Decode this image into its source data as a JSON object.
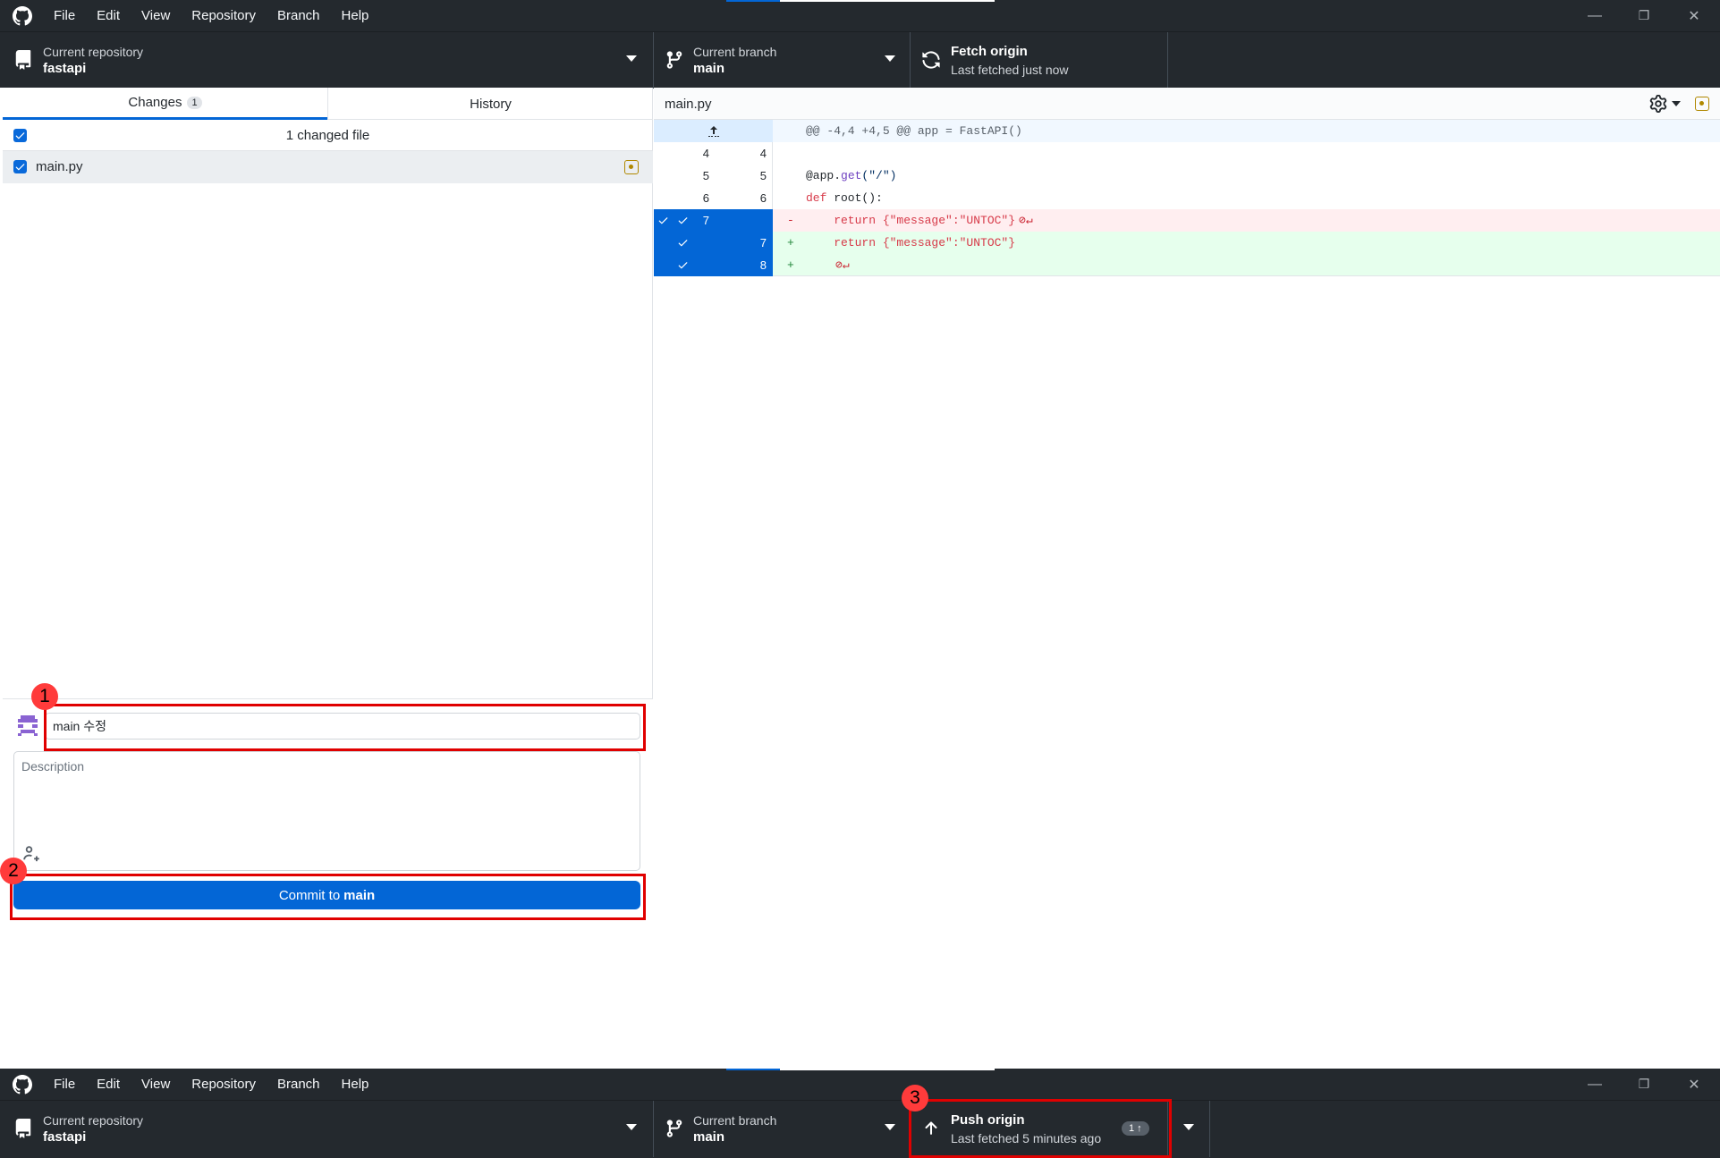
{
  "app": {
    "menu": [
      "File",
      "Edit",
      "View",
      "Repository",
      "Branch",
      "Help"
    ],
    "window_controls": {
      "minimize": "—",
      "restore": "❐",
      "close": "✕"
    }
  },
  "toolbar_top": {
    "repo_label": "Current repository",
    "repo_name": "fastapi",
    "branch_label": "Current branch",
    "branch_name": "main",
    "fetch_title": "Fetch origin",
    "fetch_sub": "Last fetched just now"
  },
  "tabs": {
    "changes_label": "Changes",
    "changes_count": "1",
    "history_label": "History"
  },
  "changes": {
    "header": "1 changed file",
    "files": [
      {
        "name": "main.py"
      }
    ]
  },
  "commit": {
    "summary_value": "main 수정",
    "description_placeholder": "Description",
    "button_prefix": "Commit to",
    "button_branch": "main"
  },
  "diff": {
    "file_name": "main.py",
    "hunk_header": "@@ -4,4 +4,5 @@ app = FastAPI()",
    "lines": [
      {
        "old": "4",
        "new": "4",
        "sign": "",
        "code": ""
      },
      {
        "old": "5",
        "new": "5",
        "sign": "",
        "code_pre": "@app.",
        "code_fn": "get",
        "code_post": "(\"/\")"
      },
      {
        "old": "6",
        "new": "6",
        "sign": "",
        "code_kw": "def",
        "code_rest": " root():"
      },
      {
        "old": "7",
        "new": "",
        "sign": "-",
        "code": "    return {\"message\":\"UNTOC\"}",
        "trail": "⊘↵"
      },
      {
        "old": "",
        "new": "7",
        "sign": "+",
        "code": "    return {\"message\":\"UNTOC\"}"
      },
      {
        "old": "",
        "new": "8",
        "sign": "+",
        "code": "",
        "trail": "⊘↵"
      }
    ]
  },
  "toolbar_bottom": {
    "repo_label": "Current repository",
    "repo_name": "fastapi",
    "branch_label": "Current branch",
    "branch_name": "main",
    "push_title": "Push origin",
    "push_sub": "Last fetched 5 minutes ago",
    "push_count": "1 ↑"
  },
  "annotations": [
    "1",
    "2",
    "3"
  ],
  "colors": {
    "accent": "#0366d6",
    "annotation": "#e00000",
    "deleted_bg": "#ffeef0",
    "added_bg": "#e6ffed"
  }
}
